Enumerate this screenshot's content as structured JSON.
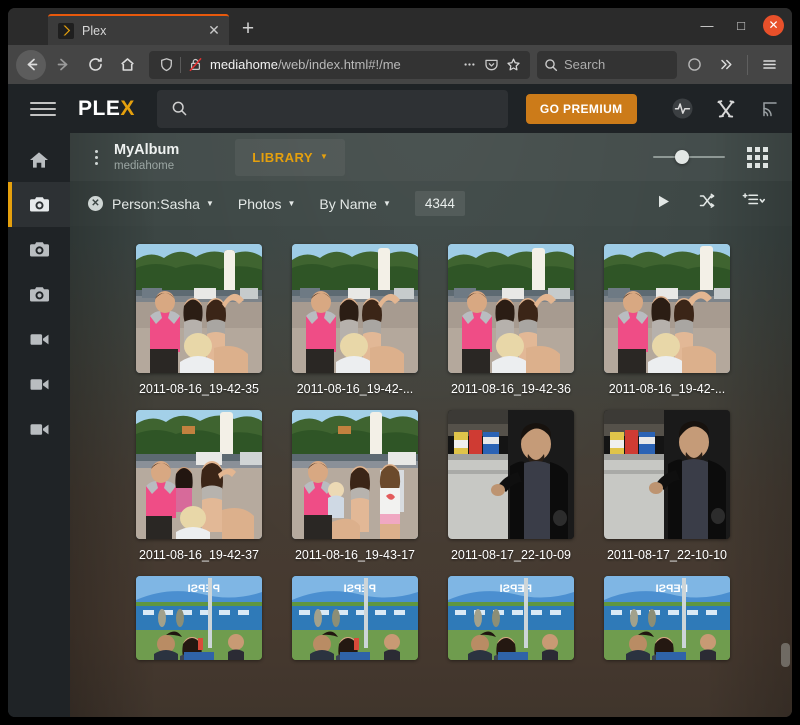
{
  "browser": {
    "tab": {
      "title": "Plex",
      "favicon_icon": "plex-chevron-icon",
      "close_icon": "close-icon"
    },
    "new_tab_label": "+",
    "window_controls": {
      "minimize": "—",
      "maximize": "□",
      "close": "✕"
    },
    "nav": {
      "back_icon": "back-arrow-icon",
      "forward_icon": "forward-arrow-icon",
      "reload_icon": "reload-icon",
      "home_icon": "home-icon",
      "shield_icon": "shield-icon",
      "insecure_icon": "broken-lock-icon",
      "page_actions_icon": "ellipsis-icon",
      "pocket_icon": "pocket-icon",
      "bookmark_icon": "star-icon",
      "account_icon": "account-circle-icon",
      "overflow_icon": "double-chevron-icon",
      "menu_icon": "hamburger-menu-icon"
    },
    "url": {
      "host": "mediahome",
      "path": "/web/index.html#!/me"
    },
    "search": {
      "placeholder": "Search",
      "icon": "search-icon"
    }
  },
  "plex": {
    "menu_icon": "hamburger-menu-icon",
    "logo": {
      "prefix": "PLE",
      "accent": "X"
    },
    "search": {
      "placeholder": "",
      "icon": "search-icon"
    },
    "premium_button": "GO PREMIUM",
    "topbar_icons": [
      "activity-icon",
      "tools-icon",
      "cast-icon"
    ],
    "rail": [
      {
        "name": "home",
        "icon": "home-icon",
        "active": false
      },
      {
        "name": "photos-1",
        "icon": "camera-icon",
        "active": true
      },
      {
        "name": "photos-2",
        "icon": "camera-icon",
        "active": false
      },
      {
        "name": "photos-3",
        "icon": "camera-icon",
        "active": false
      },
      {
        "name": "videos-1",
        "icon": "video-camera-icon",
        "active": false
      },
      {
        "name": "videos-2",
        "icon": "video-camera-icon",
        "active": false
      },
      {
        "name": "videos-3",
        "icon": "video-camera-icon",
        "active": false
      }
    ],
    "album": {
      "kebab_icon": "kebab-menu-icon",
      "title": "MyAlbum",
      "subtitle": "mediahome",
      "library_button": "LIBRARY",
      "library_caret": "▼",
      "zoom_slider_icon": "zoom-slider",
      "grid_toggle_icon": "grid-view-icon"
    },
    "filters": {
      "clear_icon": "clear-filter-icon",
      "clear_glyph": "✕",
      "person": {
        "label": "Person:Sasha",
        "caret": "▼"
      },
      "type": {
        "label": "Photos",
        "caret": "▼"
      },
      "sort": {
        "label": "By Name",
        "caret": "▼"
      },
      "count": "4344",
      "play_icon": "play-icon",
      "shuffle_icon": "shuffle-icon",
      "playlist_add_icon": "add-to-playlist-icon",
      "playlist_add_caret": "▼"
    },
    "photos": [
      {
        "caption": "2011-08-16_19-42-35",
        "scene": "group-umbrella",
        "row": 1
      },
      {
        "caption": "2011-08-16_19-42-...",
        "scene": "group-umbrella",
        "row": 1
      },
      {
        "caption": "2011-08-16_19-42-36",
        "scene": "group-umbrella",
        "row": 1
      },
      {
        "caption": "2011-08-16_19-42-...",
        "scene": "group-umbrella",
        "row": 1
      },
      {
        "caption": "2011-08-16_19-42-37",
        "scene": "group-umbrella",
        "row": 2
      },
      {
        "caption": "2011-08-16_19-43-17",
        "scene": "family-umbrella",
        "row": 2
      },
      {
        "caption": "2011-08-17_22-10-09",
        "scene": "man-indoor",
        "row": 2
      },
      {
        "caption": "2011-08-17_22-10-10",
        "scene": "man-indoor",
        "row": 2
      },
      {
        "caption": "",
        "scene": "festival-outdoor",
        "row": 3
      },
      {
        "caption": "",
        "scene": "festival-outdoor",
        "row": 3
      },
      {
        "caption": "",
        "scene": "festival-outdoor",
        "row": 3
      },
      {
        "caption": "",
        "scene": "festival-outdoor",
        "row": 3
      }
    ],
    "colors": {
      "accent": "#e5a00d",
      "premium": "#cc7b19",
      "topbar": "#1f2326",
      "content_top": "#3b4543",
      "content_bottom": "#453c33"
    }
  }
}
